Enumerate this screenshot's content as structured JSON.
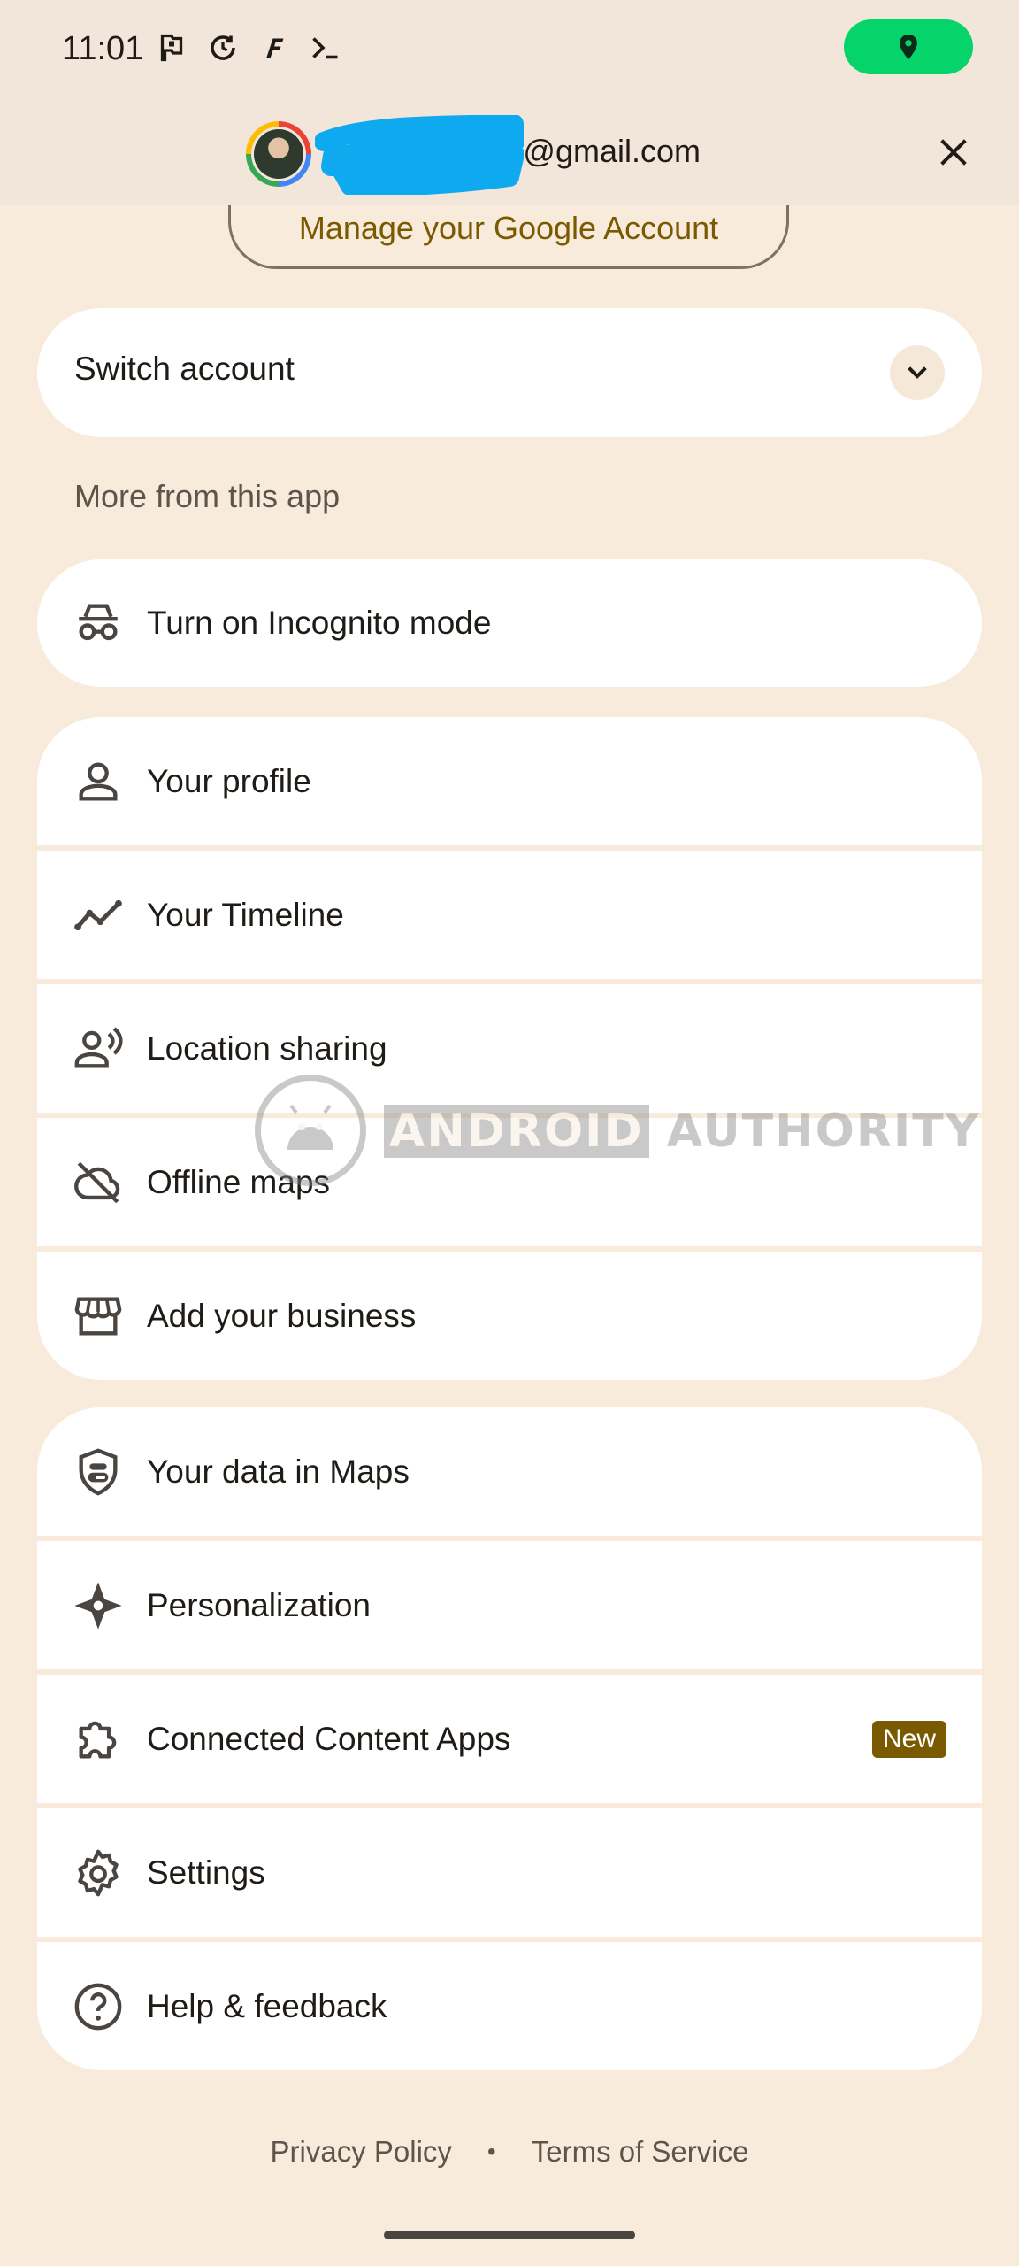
{
  "status_bar": {
    "time": "11:01",
    "icons": [
      "flag-icon",
      "sync-icon",
      "f-app-icon",
      "terminal-icon"
    ],
    "location_pill_color": "#04d46a"
  },
  "account": {
    "email_visible_part": "@gmail.com",
    "manage_label": "Manage your Google Account",
    "redaction_color": "#0ea9ef"
  },
  "switch_account": {
    "label": "Switch account"
  },
  "more_heading": "More from this app",
  "incognito": {
    "label": "Turn on Incognito mode",
    "icon": "incognito-icon"
  },
  "group1": [
    {
      "label": "Your profile",
      "icon": "person-icon"
    },
    {
      "label": "Your Timeline",
      "icon": "timeline-icon"
    },
    {
      "label": "Location sharing",
      "icon": "location-sharing-icon"
    },
    {
      "label": "Offline maps",
      "icon": "offline-maps-icon"
    },
    {
      "label": "Add your business",
      "icon": "storefront-icon"
    }
  ],
  "group2": [
    {
      "label": "Your data in Maps",
      "icon": "shield-icon"
    },
    {
      "label": "Personalization",
      "icon": "sparkle-icon"
    },
    {
      "label": "Connected Content Apps",
      "icon": "puzzle-icon",
      "badge": "New"
    },
    {
      "label": "Settings",
      "icon": "gear-icon"
    },
    {
      "label": "Help & feedback",
      "icon": "help-icon"
    }
  ],
  "footer": {
    "privacy": "Privacy Policy",
    "separator": "•",
    "terms": "Terms of Service"
  },
  "watermark": {
    "word1": "ANDROID",
    "word2": "AUTHORITY"
  },
  "colors": {
    "background": "#f8ebdc",
    "card": "#ffffff",
    "accent_brown": "#7a5a00",
    "text": "#1f1b16"
  }
}
